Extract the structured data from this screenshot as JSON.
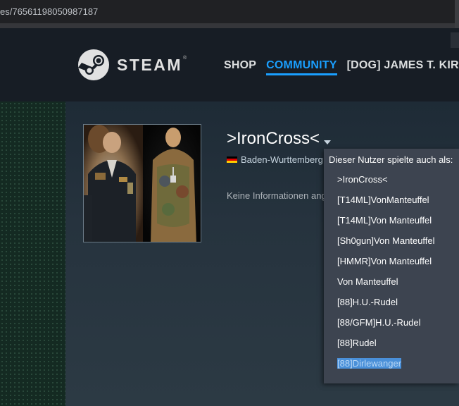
{
  "browser": {
    "url": "es/76561198050987187"
  },
  "header": {
    "logo_text": "STEAM",
    "logo_tm": "®",
    "nav": [
      {
        "label": "SHOP"
      },
      {
        "label": "COMMUNITY"
      },
      {
        "label": "[DOG] JAMES T. KIRK"
      }
    ],
    "colors": {
      "active": "#1a9fff",
      "background": "#171d25"
    }
  },
  "profile": {
    "name": ">IronCross<",
    "location": "Baden-Wurttemberg",
    "summary": "Keine Informationen angegeben.",
    "flag": "germany-flag"
  },
  "alias_popup": {
    "title": "Dieser Nutzer spielte auch als:",
    "aliases": [
      ">IronCross<",
      "[T14ML]VonManteuffel",
      "[T14ML]Von Manteuffel",
      "[Sh0gun]Von Manteuffel",
      "[HMMR]Von Manteuffel",
      "Von Manteuffel",
      "[88]H.U.-Rudel",
      "[88/GFM]H.U.-Rudel",
      "[88]Rudel",
      "[88]Dirlewanger"
    ],
    "selected_index": 9
  }
}
